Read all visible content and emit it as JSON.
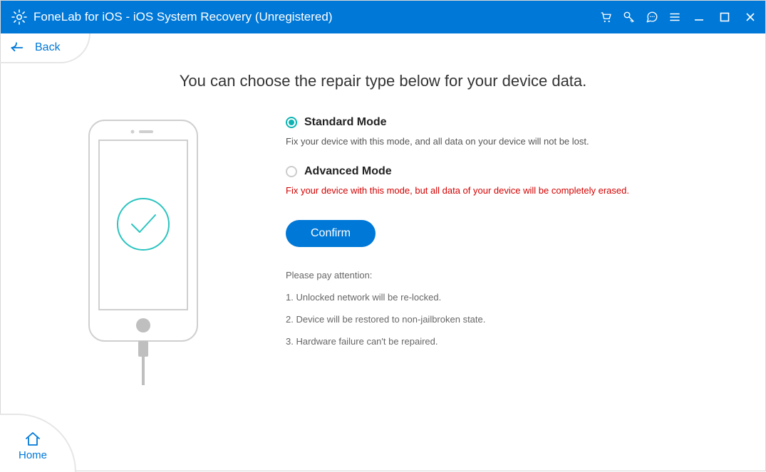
{
  "titlebar": {
    "title": "FoneLab for iOS - iOS System Recovery (Unregistered)"
  },
  "back": {
    "label": "Back"
  },
  "home": {
    "label": "Home"
  },
  "heading": "You can choose the repair type below for your device data.",
  "options": {
    "standard": {
      "title": "Standard Mode",
      "desc": "Fix your device with this mode, and all data on your device will not be lost."
    },
    "advanced": {
      "title": "Advanced Mode",
      "desc": "Fix your device with this mode, but all data of your device will be completely erased."
    }
  },
  "confirm_label": "Confirm",
  "attention": {
    "title": "Please pay attention:",
    "items": [
      "1. Unlocked network will be re-locked.",
      "2. Device will be restored to non-jailbroken state.",
      "3. Hardware failure can't be repaired."
    ]
  },
  "colors": {
    "primary": "#0078d7",
    "teal": "#0fb3b3",
    "danger": "#d40000"
  }
}
